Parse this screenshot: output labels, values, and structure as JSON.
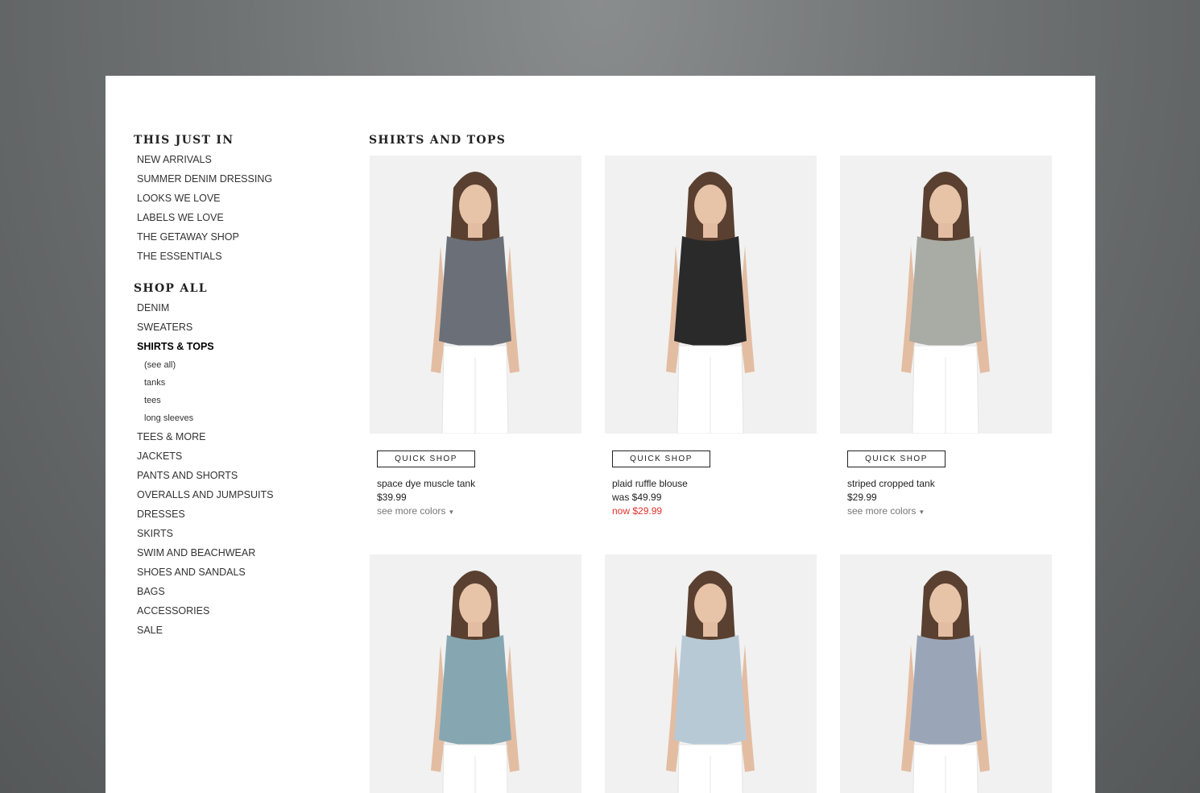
{
  "sidebar": {
    "section1_title": "THIS JUST IN",
    "section1_items": [
      "NEW ARRIVALS",
      "SUMMER DENIM DRESSING",
      "LOOKS WE LOVE",
      "LABELS WE LOVE",
      "THE GETAWAY SHOP",
      "THE ESSENTIALS"
    ],
    "section2_title": "SHOP ALL",
    "section2_items_a": [
      "DENIM",
      "SWEATERS"
    ],
    "active_item": "SHIRTS & TOPS",
    "sub_items": [
      "(see all)",
      "tanks",
      "tees",
      "long sleeves"
    ],
    "section2_items_b": [
      "TEES & MORE",
      "JACKETS",
      "PANTS AND SHORTS",
      "OVERALLS AND JUMPSUITS",
      "DRESSES",
      "SKIRTS",
      "SWIM AND BEACHWEAR",
      "SHOES AND SANDALS",
      "BAGS",
      "ACCESSORIES",
      "SALE"
    ]
  },
  "main": {
    "title": "SHIRTS AND TOPS",
    "quick_shop_label": "QUICK SHOP",
    "products": [
      {
        "name": "space dye muscle tank",
        "price": "$39.99",
        "colors_label": "see more colors",
        "top_color": "#6b7078"
      },
      {
        "name": "plaid ruffle blouse",
        "price_was": "was $49.99",
        "price_now": "now $29.99",
        "top_color": "#2a2a2a"
      },
      {
        "name": "striped cropped tank",
        "price": "$29.99",
        "colors_label": "see more colors",
        "top_color": "#a9aba5"
      }
    ],
    "row2_photos": [
      {
        "top_color": "#86a7b1"
      },
      {
        "top_color": "#b8c9d6"
      },
      {
        "top_color": "#9aa6b8"
      }
    ]
  }
}
